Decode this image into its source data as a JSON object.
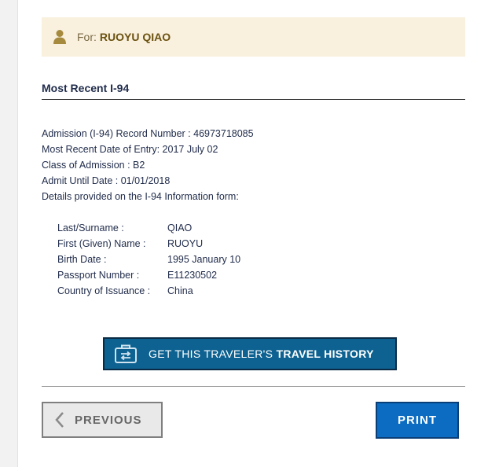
{
  "banner": {
    "for_label": "For:",
    "traveler_name": "RUOYU QIAO"
  },
  "section": {
    "title": "Most Recent I-94"
  },
  "record": {
    "admission_number": "Admission (I-94) Record Number : 46973718085",
    "entry_date": "Most Recent Date of Entry: 2017 July 02",
    "class_of_admission": "Class of Admission : B2",
    "admit_until": "Admit Until Date : 01/01/2018",
    "details_intro": "Details provided on the I-94 Information form:"
  },
  "form_info": [
    {
      "label": "Last/Surname :",
      "value": "QIAO"
    },
    {
      "label": "First (Given) Name :",
      "value": "RUOYU"
    },
    {
      "label": "Birth Date :",
      "value": "1995 January 10"
    },
    {
      "label": "Passport Number :",
      "value": "E11230502"
    },
    {
      "label": "Country of Issuance :",
      "value": "China"
    }
  ],
  "buttons": {
    "travel_history_prefix": "GET THIS TRAVELER'S ",
    "travel_history_bold": "TRAVEL HISTORY",
    "previous": "PREVIOUS",
    "print": "PRINT"
  },
  "icons": {
    "banner": "user-icon",
    "travel": "luggage-transfer-icon",
    "previous": "chevron-left-icon"
  },
  "colors": {
    "banner_bg": "#f9f0de",
    "banner_name": "#6b5210",
    "travel_button": "#0d6291",
    "print_button": "#0b6cc1",
    "previous_button": "#e9e9e9"
  }
}
